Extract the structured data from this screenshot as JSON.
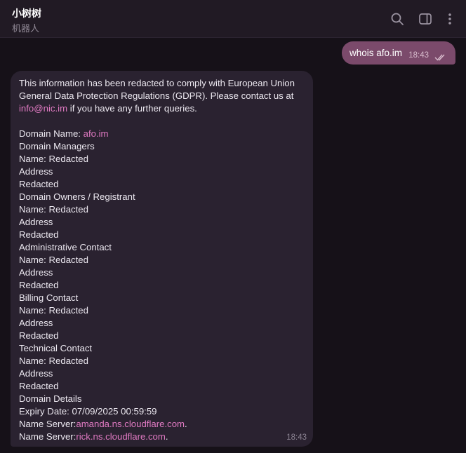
{
  "header": {
    "title": "小树树",
    "subtitle": "机器人",
    "icons": [
      "search-icon",
      "sidebar-toggle-icon",
      "more-vertical-icon"
    ]
  },
  "outgoing": {
    "prefix": "whois ",
    "link": "afo.im",
    "time": "18:43",
    "status_icon": "double-check-icon"
  },
  "incoming": {
    "intro_text": "This information has been redacted to comply with European Union General Data Protection Regulations (GDPR). Please contact us at ",
    "intro_link": "info@nic.im",
    "intro_suffix": " if you have any further queries.",
    "domain_label": "Domain Name: ",
    "domain_link": "afo.im",
    "lines": [
      "Domain Managers",
      "Name: Redacted",
      "Address",
      "Redacted",
      "Domain Owners / Registrant",
      "Name: Redacted",
      "Address",
      "Redacted",
      "Administrative Contact",
      "Name: Redacted",
      "Address",
      "Redacted",
      "Billing Contact",
      "Name: Redacted",
      "Address",
      "Redacted",
      "Technical Contact",
      "Name: Redacted",
      "Address",
      "Redacted",
      "Domain Details",
      "Expiry Date: 07/09/2025 00:59:59"
    ],
    "ns_label": "Name Server:",
    "ns1": "amanda.ns.cloudflare.com",
    "ns2": "rick.ns.cloudflare.com",
    "ns_suffix": ".",
    "time": "18:43"
  }
}
